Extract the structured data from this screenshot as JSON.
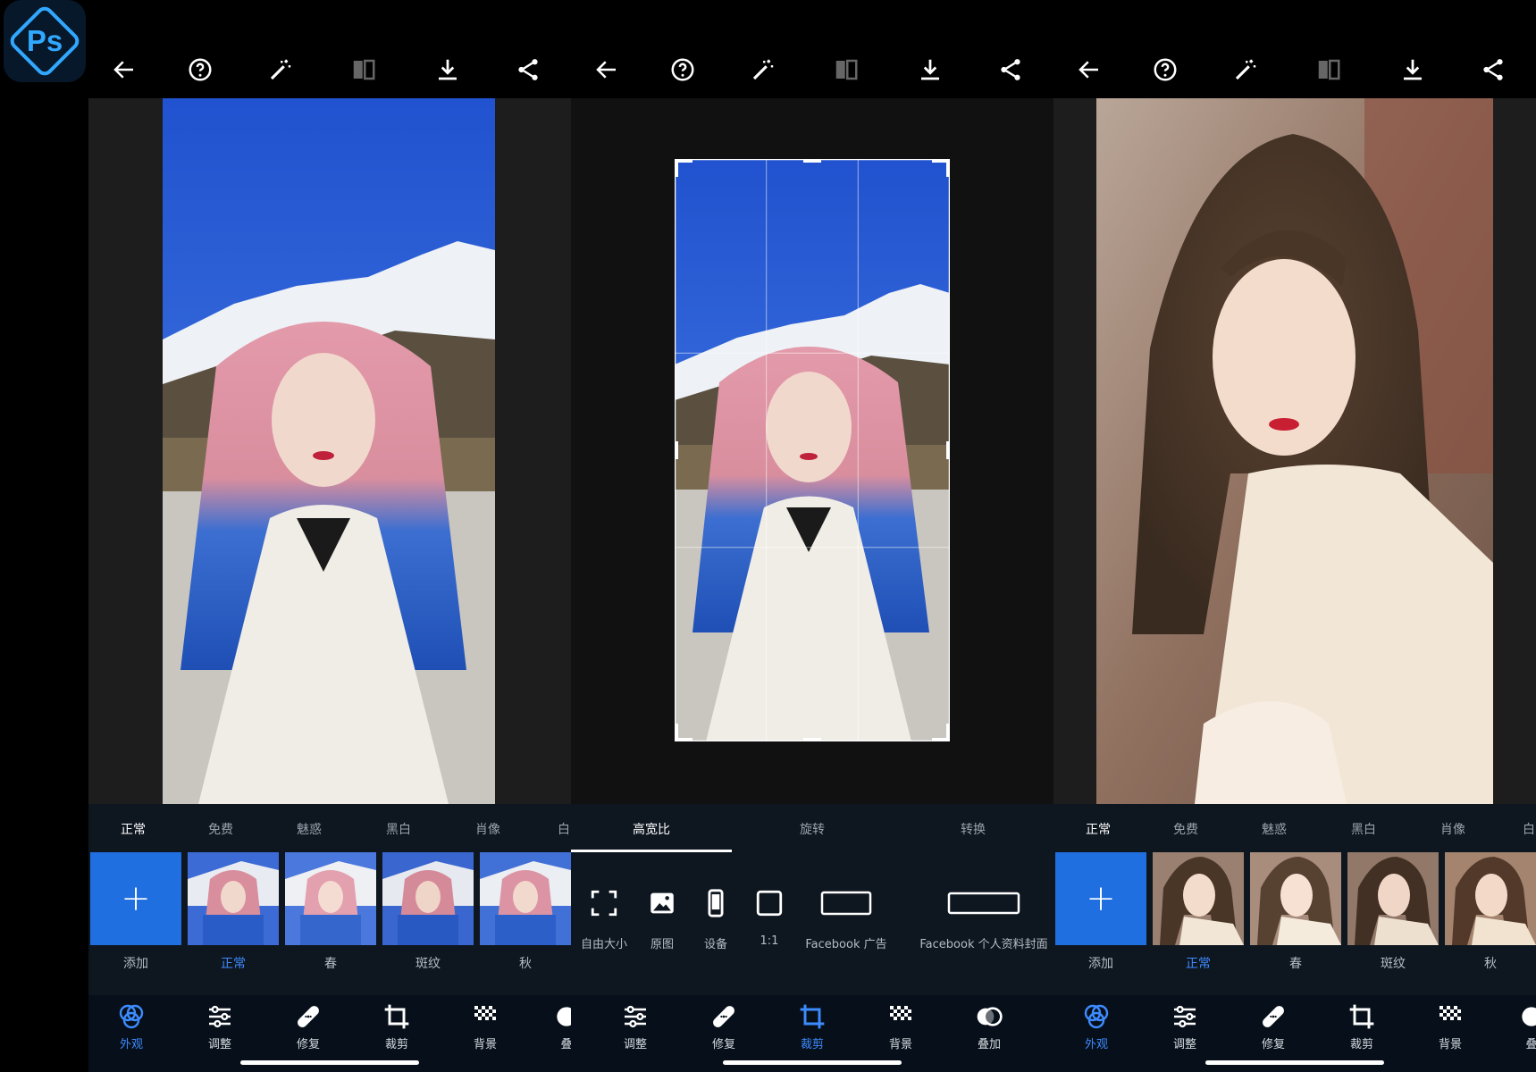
{
  "app": {
    "logo_text": "Ps"
  },
  "panel1": {
    "tabs": [
      "正常",
      "免费",
      "魅惑",
      "黑白",
      "肖像",
      "白"
    ],
    "active_tab": 0,
    "thumbnails": [
      {
        "label": "添加",
        "type": "add"
      },
      {
        "label": "正常",
        "active": true
      },
      {
        "label": "春"
      },
      {
        "label": "斑纹"
      },
      {
        "label": "秋"
      }
    ],
    "nav": [
      {
        "label": "外观",
        "icon": "looks-icon",
        "active": true
      },
      {
        "label": "调整",
        "icon": "sliders-icon"
      },
      {
        "label": "修复",
        "icon": "bandage-icon"
      },
      {
        "label": "裁剪",
        "icon": "crop-icon"
      },
      {
        "label": "背景",
        "icon": "background-icon"
      },
      {
        "label": "叠",
        "icon": "overlay-icon"
      }
    ]
  },
  "panel2": {
    "tabs": [
      "高宽比",
      "旋转",
      "转换"
    ],
    "active_tab": 0,
    "crop_options": [
      {
        "label": "自由大小",
        "icon": "free-size-icon"
      },
      {
        "label": "原图",
        "icon": "original-icon"
      },
      {
        "label": "设备",
        "icon": "device-icon"
      },
      {
        "label": "1:1",
        "icon": "square-icon"
      },
      {
        "label": "Facebook 广告",
        "icon": "wide-rect-icon"
      },
      {
        "label": "Facebook 个人资料封面",
        "icon": "cover-rect-icon"
      }
    ],
    "nav": [
      {
        "label": "调整",
        "icon": "sliders-icon"
      },
      {
        "label": "修复",
        "icon": "bandage-icon"
      },
      {
        "label": "裁剪",
        "icon": "crop-icon",
        "active": true
      },
      {
        "label": "背景",
        "icon": "background-icon"
      },
      {
        "label": "叠加",
        "icon": "overlay-icon"
      }
    ]
  },
  "panel3": {
    "tabs": [
      "正常",
      "免费",
      "魅惑",
      "黑白",
      "肖像",
      "白"
    ],
    "active_tab": 0,
    "thumbnails": [
      {
        "label": "添加",
        "type": "add"
      },
      {
        "label": "正常",
        "active": true
      },
      {
        "label": "春"
      },
      {
        "label": "斑纹"
      },
      {
        "label": "秋"
      }
    ],
    "nav": [
      {
        "label": "外观",
        "icon": "looks-icon",
        "active": true
      },
      {
        "label": "调整",
        "icon": "sliders-icon"
      },
      {
        "label": "修复",
        "icon": "bandage-icon"
      },
      {
        "label": "裁剪",
        "icon": "crop-icon"
      },
      {
        "label": "背景",
        "icon": "background-icon"
      },
      {
        "label": "叠",
        "icon": "overlay-icon"
      }
    ]
  },
  "colors": {
    "accent": "#3d8bff",
    "add_button": "#1f6fe0",
    "panel_bg": "#0e1620",
    "sky": "#2a62d8"
  }
}
